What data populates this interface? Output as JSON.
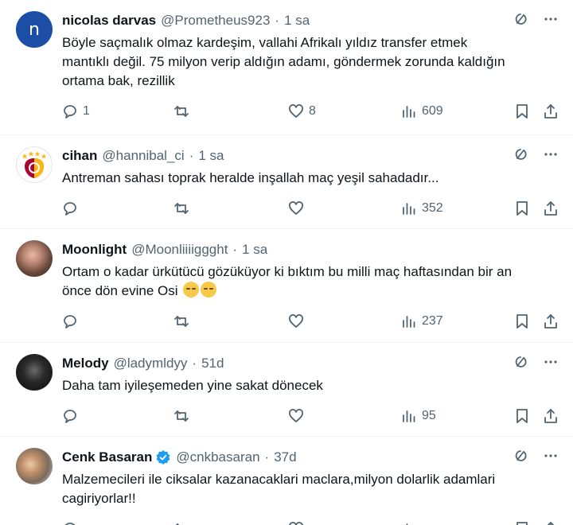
{
  "tweets": [
    {
      "avatar_letter": "n",
      "name": "nicolas darvas",
      "handle": "@Prometheus923",
      "time": "1 sa",
      "body_lines": [
        "Böyle saçmalık olmaz kardeşim, vallahi Afrikalı yıldız transfer etmek",
        "mantıklı değil. 75 milyon verip aldığın adamı, göndermek zorunda kaldığın",
        "ortama bak, rezillik"
      ],
      "replies": "1",
      "retweets": "",
      "likes": "8",
      "views": "609"
    },
    {
      "avatar_letter": "",
      "name": "cihan",
      "handle": "@hannibal_ci",
      "time": "1 sa",
      "body_lines": [
        "Antreman sahası toprak heralde inşallah maç yeşil sahadadır..."
      ],
      "replies": "",
      "retweets": "",
      "likes": "",
      "views": "352"
    },
    {
      "avatar_letter": "",
      "name": "Moonlight",
      "handle": "@Moonliiiiggght",
      "time": "1 sa",
      "body_lines": [
        "Ortam o kadar ürkütücü gözüküyor ki bıktım bu milli maç haftasından bir an",
        "önce dön evine Osi"
      ],
      "replies": "",
      "retweets": "",
      "likes": "",
      "views": "237"
    },
    {
      "avatar_letter": "",
      "name": "Melody",
      "handle": "@ladymldyy",
      "time": "51d",
      "body_lines": [
        "Daha tam iyileşemeden yine sakat dönecek"
      ],
      "replies": "",
      "retweets": "",
      "likes": "",
      "views": "95"
    },
    {
      "avatar_letter": "",
      "name": "Cenk Basaran",
      "handle": "@cnkbasaran",
      "time": "37d",
      "body_lines": [
        "Malzemecileri ile ciksalar kazanacaklari maclara,milyon dolarlik adamlari",
        "cagiriyorlar!!"
      ],
      "replies": "",
      "retweets": "",
      "likes": "",
      "views": ""
    }
  ],
  "colors": {
    "text": "#0f1419",
    "muted": "#536471",
    "verified": "#1d9bf0",
    "gs_red": "#a90432",
    "gs_yellow": "#fdb912"
  },
  "icons": [
    "reply-icon",
    "retweet-icon",
    "like-icon",
    "views-icon",
    "bookmark-icon",
    "share-icon",
    "grok-icon",
    "more-icon",
    "verified-badge-icon"
  ]
}
